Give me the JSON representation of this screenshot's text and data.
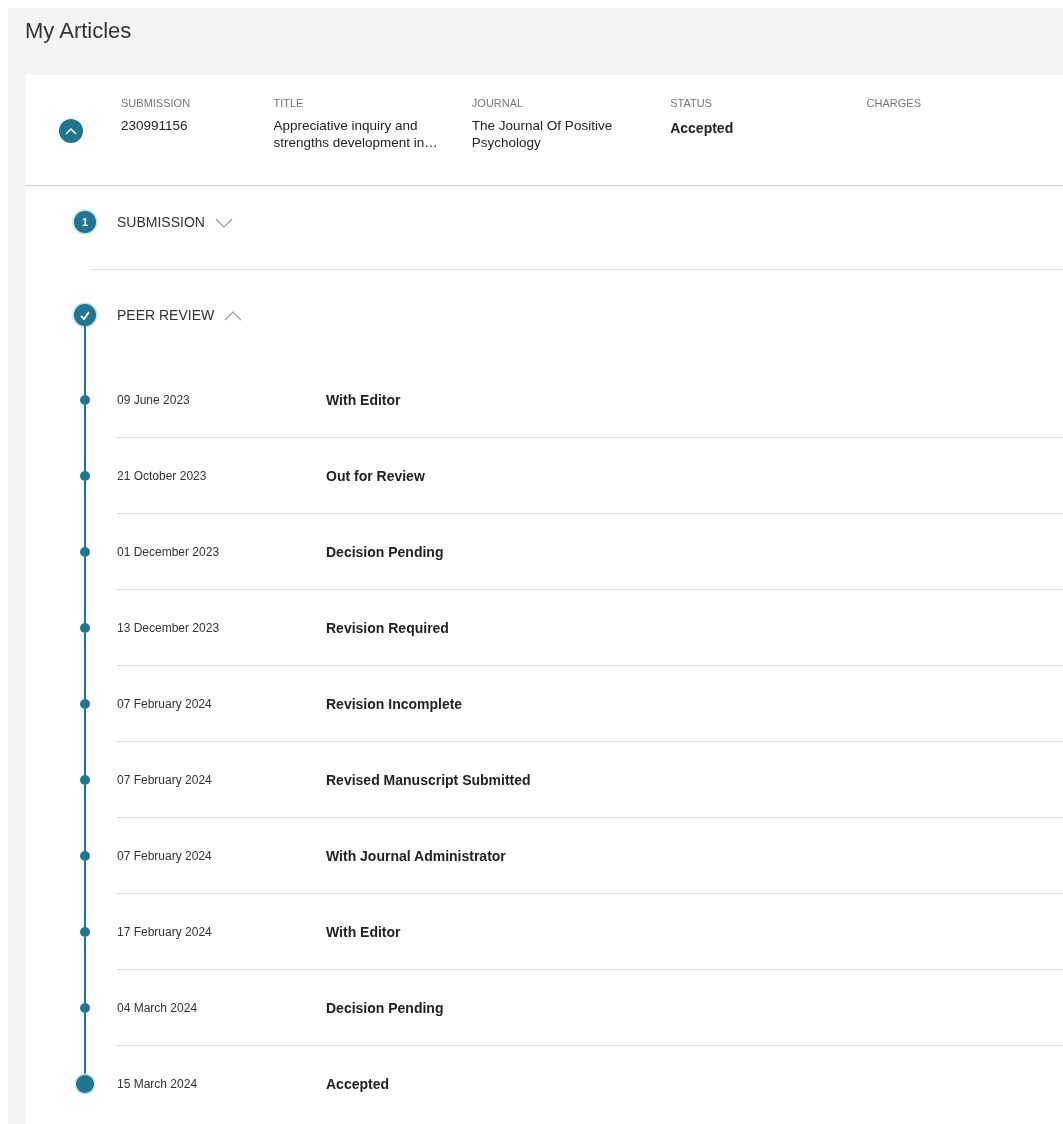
{
  "page_title": "My Articles",
  "article": {
    "expanded": true,
    "columns": [
      {
        "label": "SUBMISSION",
        "value": "230991156",
        "kind": "text"
      },
      {
        "label": "TITLE",
        "value": "Appreciative inquiry and strengths development in…",
        "kind": "text"
      },
      {
        "label": "JOURNAL",
        "value": "The Journal Of Positive Psychology",
        "kind": "text"
      },
      {
        "label": "STATUS",
        "value": "Accepted",
        "kind": "status"
      },
      {
        "label": "CHARGES"
      }
    ]
  },
  "steps": [
    {
      "title": "SUBMISSION",
      "marker": "1",
      "kind": "number",
      "expanded": false
    },
    {
      "title": "PEER REVIEW",
      "kind": "done",
      "expanded": true,
      "events": [
        {
          "date": "09 June 2023",
          "status": "With Editor",
          "current": false
        },
        {
          "date": "21 October 2023",
          "status": "Out for Review",
          "current": false
        },
        {
          "date": "01 December 2023",
          "status": "Decision Pending",
          "current": false
        },
        {
          "date": "13 December 2023",
          "status": "Revision Required",
          "current": false
        },
        {
          "date": "07 February 2024",
          "status": "Revision Incomplete",
          "current": false
        },
        {
          "date": "07 February 2024",
          "status": "Revised Manuscript Submitted",
          "current": false
        },
        {
          "date": "07 February 2024",
          "status": "With Journal Administrator",
          "current": false
        },
        {
          "date": "17 February 2024",
          "status": "With Editor",
          "current": false
        },
        {
          "date": "04 March 2024",
          "status": "Decision Pending",
          "current": false
        },
        {
          "date": "15 March 2024",
          "status": "Accepted",
          "current": true
        }
      ]
    }
  ]
}
